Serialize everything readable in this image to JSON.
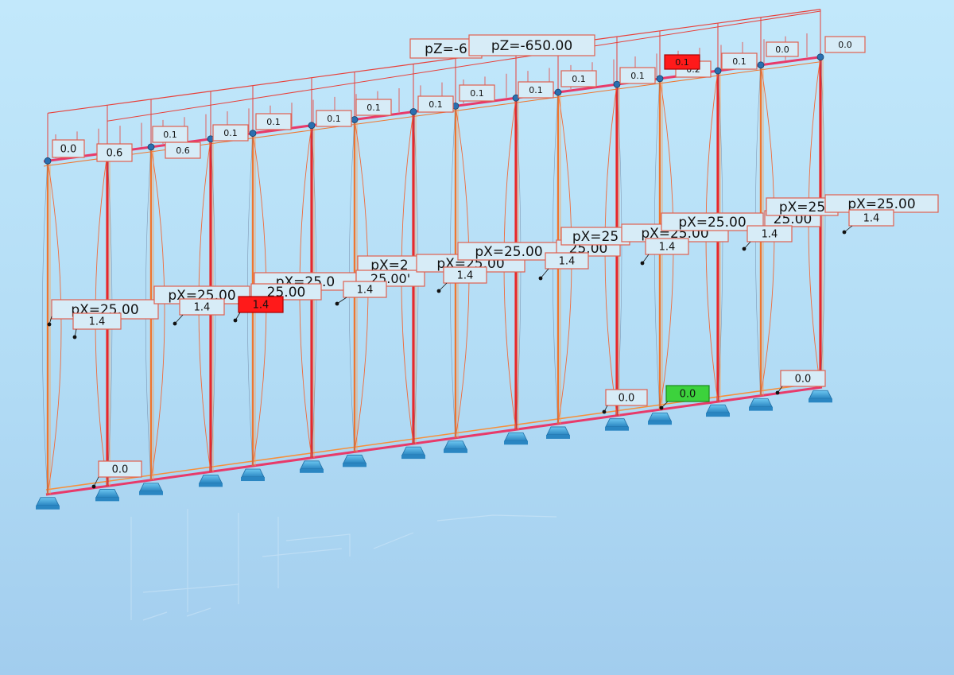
{
  "view": {
    "background_top": "#c2e8fb",
    "background_bottom": "#a2cdee",
    "member_color": "#f0762e",
    "column_color": "#e8282a",
    "beam_color": "#e83a6a",
    "support_color": "#3aa4d8",
    "label_fill": "#d7ecf7",
    "label_border": "#e06050",
    "highlight_red": "#ff1a1a",
    "highlight_green": "#3cd23c"
  },
  "load_labels": {
    "pz_back": "pZ=-6",
    "pz_front": "pZ=-650.00",
    "px": "pX=25.00",
    "px_a": "pX=2",
    "px_b": "pX=25",
    "px_tail": "25.00",
    "px_tail_q": "25.00'",
    "px_d": "pX=25.0",
    "px_e": "pX=25.00",
    "px_f": "25.00",
    "px_g": "pX=25",
    "px_h": "pX=2",
    "px_i": "25.00",
    "px_j": "pX=25.00"
  },
  "top_values": [
    "0.0",
    "0.6",
    "0.1",
    "0.6",
    "0.1",
    "0.1",
    "0.1",
    "0.1",
    "0.1",
    "0.1",
    "0.1",
    "0.1",
    "0.1",
    "0.2",
    "0.1",
    "0.0",
    "0.0"
  ],
  "top_red_value": "0.1",
  "mid_values": [
    "1.4",
    "1.4",
    "1.4",
    "1.4",
    "1.4",
    "1.4",
    "1.4",
    "1.4",
    "1.4"
  ],
  "mid_red_value": "1.4",
  "bottom_values": [
    "0.0",
    "0.0",
    "0.0"
  ],
  "bottom_green_value": "0.0"
}
